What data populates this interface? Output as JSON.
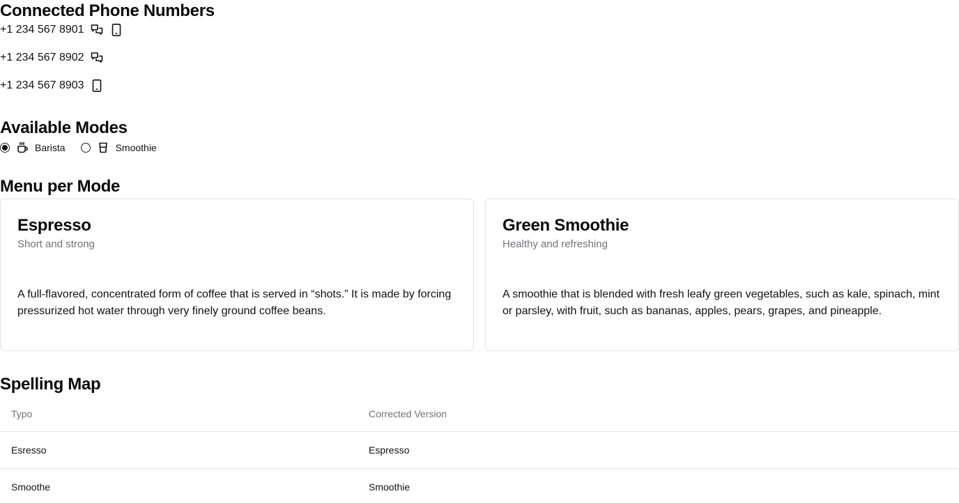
{
  "phones": {
    "heading": "Connected Phone Numbers",
    "items": [
      {
        "number": "+1 234 567 8901",
        "icons": [
          "chat-icon",
          "smartphone-icon"
        ]
      },
      {
        "number": "+1 234 567 8902",
        "icons": [
          "chat-icon"
        ]
      },
      {
        "number": "+1 234 567 8903",
        "icons": [
          "smartphone-icon"
        ]
      }
    ]
  },
  "modes": {
    "heading": "Available Modes",
    "options": [
      {
        "label": "Barista",
        "icon": "coffee-cup-icon",
        "checked": true
      },
      {
        "label": "Smoothie",
        "icon": "smoothie-cup-icon",
        "checked": false
      }
    ]
  },
  "menu": {
    "heading": "Menu per Mode",
    "cards": [
      {
        "title": "Espresso",
        "description": "Short and strong",
        "body": "A full-flavored, concentrated form of coffee that is served in “shots.” It is made by forcing pressurized hot water through very finely ground coffee beans."
      },
      {
        "title": "Green Smoothie",
        "description": "Healthy and refreshing",
        "body": "A smoothie that is blended with fresh leafy green vegetables, such as kale, spinach, mint or parsley, with fruit, such as bananas, apples, pears, grapes, and pineapple."
      }
    ]
  },
  "spelling": {
    "heading": "Spelling Map",
    "columns": [
      "Typo",
      "Corrected Version"
    ],
    "rows": [
      [
        "Esresso",
        "Espresso"
      ],
      [
        "Smoothe",
        "Smoothie"
      ]
    ]
  }
}
